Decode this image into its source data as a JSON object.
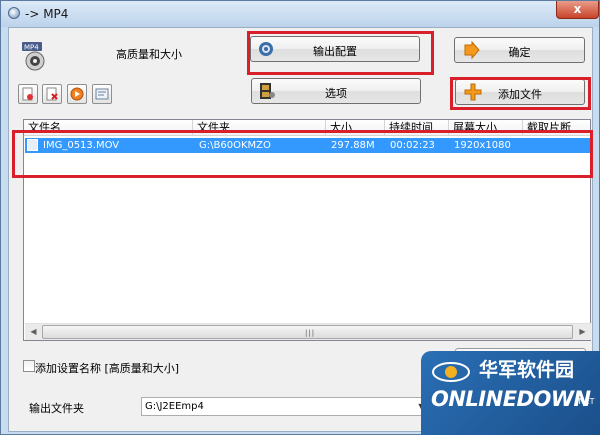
{
  "window": {
    "title": "-> MP4",
    "close_glyph": "x"
  },
  "preset": {
    "label": "高质量和大小",
    "icon": "mp4-format-icon"
  },
  "buttons": {
    "output_config": "输出配置",
    "ok": "确定",
    "options": "选项",
    "add_file": "添加文件"
  },
  "toolbar_icons": [
    "delete-file-icon",
    "remove-file-icon",
    "play-icon",
    "info-icon"
  ],
  "list": {
    "columns": [
      "文件名",
      "文件夹",
      "大小",
      "持续时间",
      "屏幕大小",
      "截取片断"
    ],
    "rows": [
      {
        "name": "IMG_0513.MOV",
        "folder": "G:\\B60OKMZO",
        "size": "297.88M",
        "duration": "00:02:23",
        "screen": "1920x1080",
        "clip": ""
      }
    ]
  },
  "bottom": {
    "add_setting_label": "添加设置名称 [高质量和大小]",
    "add_setting_checked": false,
    "output_folder_label": "输出文件夹",
    "output_folder_value": "G:\\J2EEmp4"
  },
  "watermark": {
    "cn": "华军软件园",
    "en": "ONLINEDOWN",
    "suffix": ".NET"
  },
  "colors": {
    "selection": "#3399ff",
    "highlight_box": "#d9202a",
    "watermark_bg": "#2a6fb5"
  }
}
